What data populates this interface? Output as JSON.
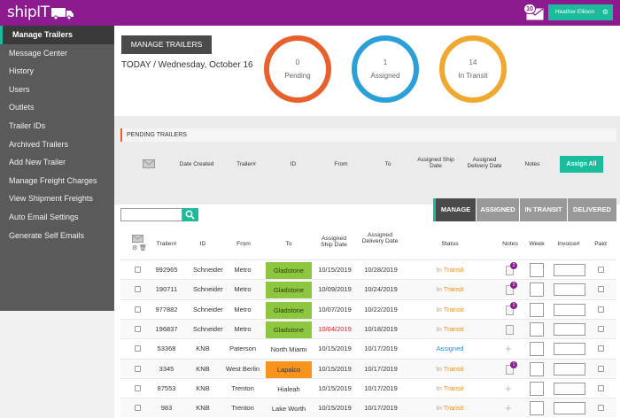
{
  "app": {
    "logo": "shipIT",
    "mail_count": "10",
    "user_name": "Heather Ellison"
  },
  "sidebar": {
    "items": [
      {
        "label": "Manage Trailers",
        "active": true
      },
      {
        "label": "Message Center"
      },
      {
        "label": "History"
      },
      {
        "label": "Users"
      },
      {
        "label": "Outlets"
      },
      {
        "label": "Trailer IDs"
      },
      {
        "label": "Archived Trailers"
      },
      {
        "label": "Add New Trailer"
      },
      {
        "label": "Manage Freight Charges"
      },
      {
        "label": "View Shipment Freights"
      },
      {
        "label": "Auto Email Settings"
      },
      {
        "label": "Generate Self Emails"
      }
    ]
  },
  "header": {
    "manage_button": "MANAGE TRAILERS",
    "date_text": "TODAY / Wednesday, October 16"
  },
  "stats": [
    {
      "count": "0",
      "label": "Pending",
      "color": "#e8612c"
    },
    {
      "count": "1",
      "label": "Assigned",
      "color": "#2a9fd8"
    },
    {
      "count": "14",
      "label": "In Transit",
      "color": "#f0a830"
    }
  ],
  "pending": {
    "title": "PENDING TRAILERS",
    "columns": {
      "date_created": "Date Created",
      "trailer": "Trailer#",
      "id": "ID",
      "from": "From",
      "to": "To",
      "ship_date": "Assigned Ship Date",
      "delivery_date": "Assigned Delivery Date",
      "notes": "Notes"
    },
    "assign_all": "Assign All"
  },
  "tabs": [
    "MANAGE",
    "ASSIGNED",
    "IN TRANSIT",
    "DELIVERED"
  ],
  "table": {
    "columns": {
      "trailer": "Trailer#",
      "id": "ID",
      "from": "From",
      "to": "To",
      "ship": "Assigned Ship Date",
      "delivery": "Assigned Delivery Date",
      "status": "Status",
      "notes": "Notes",
      "week": "Week",
      "invoice": "Invoice#",
      "paid": "Paid"
    },
    "rows": [
      {
        "trailer": "992965",
        "id": "Schneider",
        "from": "Metro",
        "to": "Gladstone",
        "ship": "10/15/2019",
        "delivery": "10/28/2019",
        "status": "In Transit",
        "to_color": "#8dc63f",
        "note": "2"
      },
      {
        "trailer": "190711",
        "id": "Schneider",
        "from": "Metro",
        "to": "Gladstone",
        "ship": "10/09/2019",
        "delivery": "10/24/2019",
        "status": "In Transit",
        "to_color": "#8dc63f",
        "note": "2"
      },
      {
        "trailer": "977882",
        "id": "Schneider",
        "from": "Metro",
        "to": "Gladstone",
        "ship": "10/07/2019",
        "delivery": "10/22/2019",
        "status": "In Transit",
        "to_color": "#8dc63f",
        "note": "2"
      },
      {
        "trailer": "196837",
        "id": "Schneider",
        "from": "Metro",
        "to": "Gladstone",
        "ship": "10/04/2019",
        "delivery": "10/18/2019",
        "status": "In Transit",
        "to_color": "#8dc63f",
        "note": "doc",
        "ship_red": true
      },
      {
        "trailer": "53368",
        "id": "KNB",
        "from": "Paterson",
        "to": "North Miami",
        "ship": "10/15/2019",
        "delivery": "10/17/2019",
        "status": "Assigned",
        "note": "plus"
      },
      {
        "trailer": "3345",
        "id": "KNB",
        "from": "West Berlin",
        "to": "Lapalco",
        "ship": "10/15/2019",
        "delivery": "10/17/2019",
        "status": "In Transit",
        "to_color": "#f7941d",
        "note": "1"
      },
      {
        "trailer": "87553",
        "id": "KNB",
        "from": "Trenton",
        "to": "Hialeah",
        "ship": "10/15/2019",
        "delivery": "10/17/2019",
        "status": "In Transit",
        "note": "plus"
      },
      {
        "trailer": "983",
        "id": "KNB",
        "from": "Trenton",
        "to": "Lake Worth",
        "ship": "10/15/2019",
        "delivery": "10/17/2019",
        "status": "In Transit",
        "note": "plus"
      }
    ]
  },
  "colors": {
    "brand": "#8b1b8f",
    "accent": "#1abc9c",
    "ship_overdue": "#e81c1c"
  }
}
